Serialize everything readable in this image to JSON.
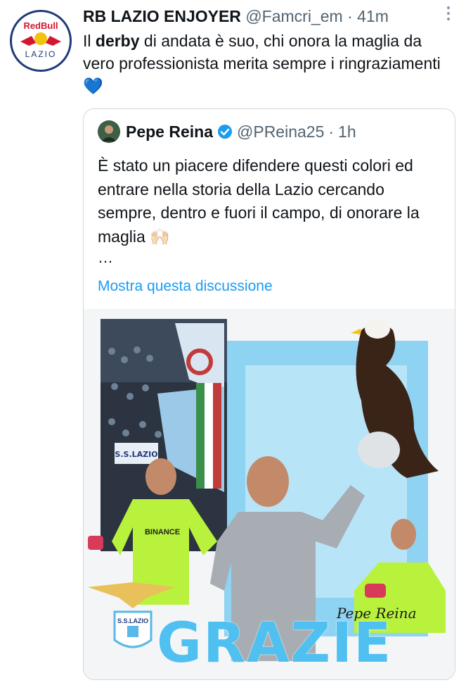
{
  "tweet": {
    "display_name": "RB LAZIO ENJOYER",
    "handle": "@Famcri_em",
    "separator": "·",
    "time": "41m",
    "more_icon": "more-dots-icon",
    "text_before": "Il ",
    "text_bold": "derby",
    "text_after": " di andata è suo, chi onora la maglia da vero professionista merita sempre i ringraziamenti",
    "emoji": "💙",
    "avatar_logo_text": "RedBull",
    "avatar_logo_sub": "LAZIO"
  },
  "quote": {
    "display_name": "Pepe Reina",
    "verified_icon": "verified-badge-icon",
    "handle": "@PReina25",
    "separator": "·",
    "time": "1h",
    "text": "È stato un piacere difendere questi colori ed entrare nella storia della Lazio cercando sempre, dentro e fuori il campo, di onorare la maglia 🙌🏻",
    "ellipsis": "…",
    "show_thread": "Mostra questa discussione",
    "media": {
      "grazie_text": "GRAZIE",
      "signature": "Pepe Reina",
      "banner_text": "S.S.LAZIO",
      "shirt_sponsor": "BINANCE",
      "crest_text": "S.S.LAZIO"
    }
  },
  "colors": {
    "link": "#1d9bf0",
    "verified": "#1d9bf0",
    "sky": "#4fc0f0",
    "keeper_green": "#b9f23c"
  }
}
